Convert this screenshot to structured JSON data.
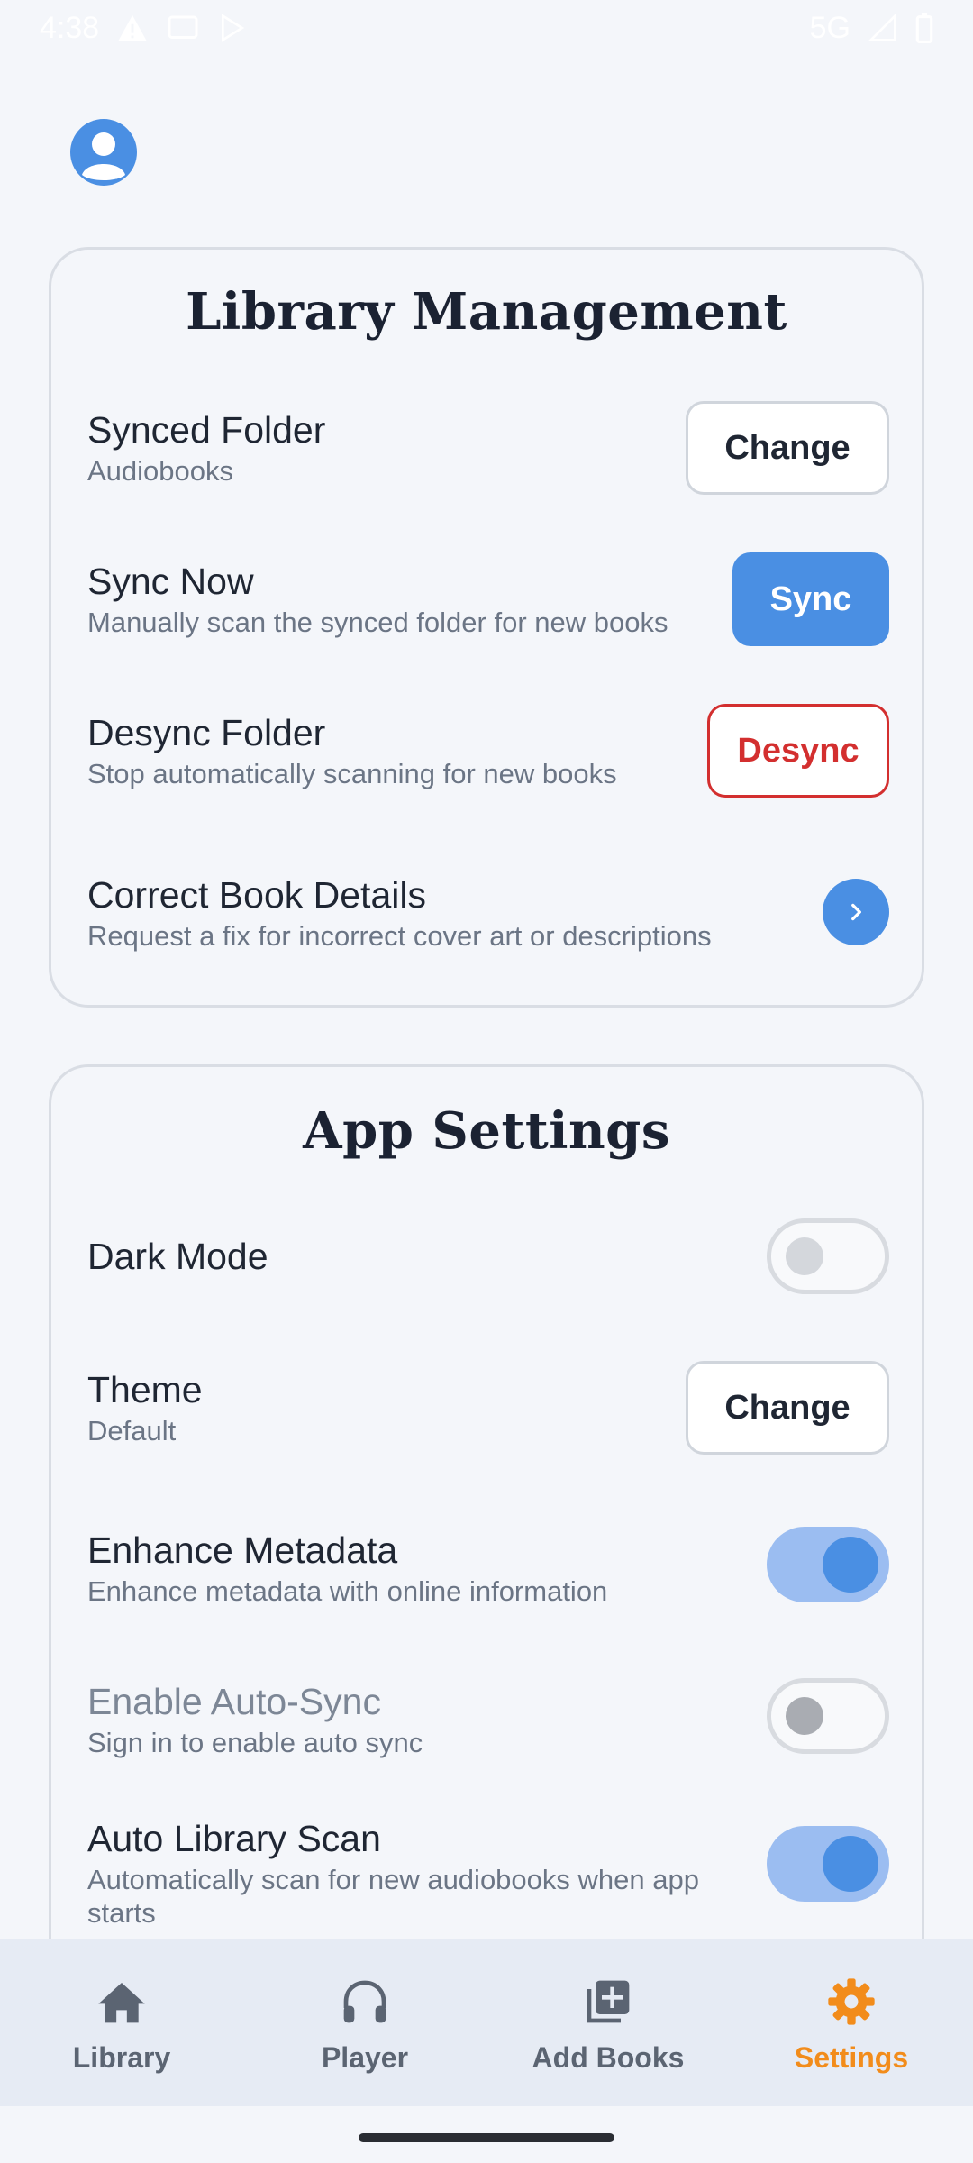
{
  "status_bar": {
    "time": "4:38",
    "network": "5G",
    "left_icons": [
      "alert-icon",
      "cast-icon",
      "play-store-icon"
    ],
    "right_icons": [
      "signal-icon",
      "battery-icon"
    ]
  },
  "profile": {
    "icon": "account-circle-icon"
  },
  "library_management": {
    "title": "Library Management",
    "synced_folder": {
      "title": "Synced Folder",
      "subtitle": "Audiobooks",
      "button": "Change"
    },
    "sync_now": {
      "title": "Sync Now",
      "subtitle": "Manually scan the synced folder for new books",
      "button": "Sync"
    },
    "desync_folder": {
      "title": "Desync Folder",
      "subtitle": "Stop automatically scanning for new books",
      "button": "Desync"
    },
    "correct_details": {
      "title": "Correct Book Details",
      "subtitle": "Request a fix for incorrect cover art or descriptions",
      "icon": "chevron-right-icon"
    }
  },
  "app_settings": {
    "title": "App Settings",
    "dark_mode": {
      "title": "Dark Mode",
      "enabled": false
    },
    "theme": {
      "title": "Theme",
      "subtitle": "Default",
      "button": "Change"
    },
    "enhance_metadata": {
      "title": "Enhance Metadata",
      "subtitle": "Enhance metadata with online information",
      "enabled": true
    },
    "auto_sync": {
      "title": "Enable Auto-Sync",
      "subtitle": "Sign in to enable auto sync",
      "enabled": false,
      "disabled": true
    },
    "auto_scan": {
      "title": "Auto Library Scan",
      "subtitle": "Automatically scan for new audiobooks when app starts",
      "enabled": true
    }
  },
  "bottom_nav": {
    "items": [
      {
        "label": "Library",
        "icon": "home-icon",
        "active": false
      },
      {
        "label": "Player",
        "icon": "headphones-icon",
        "active": false
      },
      {
        "label": "Add Books",
        "icon": "library-add-icon",
        "active": false
      },
      {
        "label": "Settings",
        "icon": "gear-icon",
        "active": true
      }
    ]
  },
  "colors": {
    "accent": "#4a8fe3",
    "danger": "#d32f2f",
    "active_nav": "#f28c1b",
    "background": "#f4f6fa"
  }
}
